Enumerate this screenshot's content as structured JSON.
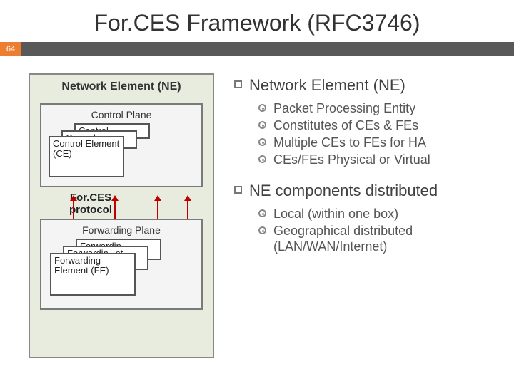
{
  "title": "For.CES Framework (RFC3746)",
  "slide_number": "64",
  "diagram": {
    "ne_label": "Network Element (NE)",
    "control_plane_label": "Control Plane",
    "ce_back1": "Control",
    "ce_back2": "Control",
    "ce_front": "Control Element (CE)",
    "protocol_label": "For.CES protocol",
    "forwarding_plane_label": "Forwarding Plane",
    "fe_back1": "Forwardin",
    "fe_back2_a": "Forwardin",
    "fe_back2_b": "nt",
    "fe_front": "Forwarding Element (FE)",
    "fe_mid_nt": "nt"
  },
  "bullets": {
    "b1": "Network Element (NE)",
    "s1": "Packet Processing Entity",
    "s2": "Constitutes of CEs & FEs",
    "s3": "Multiple CEs to FEs for HA",
    "s4": "CEs/FEs Physical or Virtual",
    "b2": "NE components distributed",
    "s5": "Local (within one box)",
    "s6": "Geographical distributed (LAN/WAN/Internet)"
  }
}
